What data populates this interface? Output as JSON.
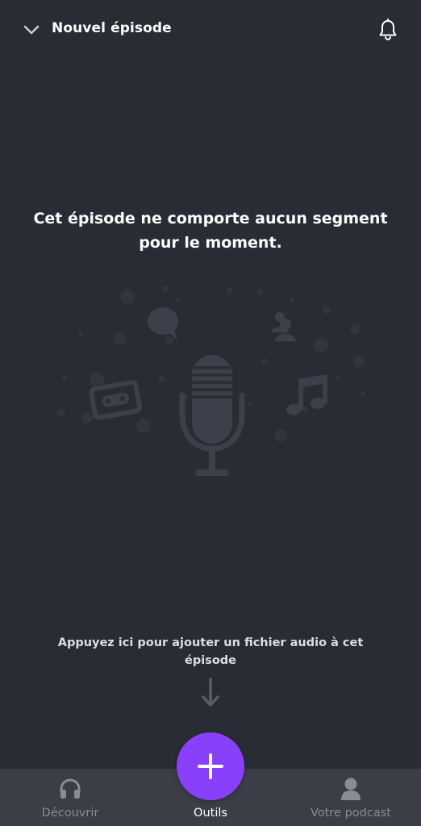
{
  "header": {
    "title": "Nouvel épisode",
    "collapse_icon": "chevron-down-icon",
    "notification_icon": "bell-icon"
  },
  "empty_state": {
    "message": "Cet épisode ne comporte aucun segment pour le moment.",
    "illustration_icons": [
      "microphone-icon",
      "speech-bubble-icon",
      "users-icon",
      "cassette-icon",
      "music-note-icon"
    ]
  },
  "hint": {
    "text": "Appuyez ici pour ajouter un fichier audio à cet épisode",
    "arrow_icon": "arrow-down-icon"
  },
  "fab": {
    "icon": "plus-icon",
    "color": "#8940fa"
  },
  "bottom_nav": {
    "items": [
      {
        "label": "Découvrir",
        "icon": "headphones-icon",
        "active": false
      },
      {
        "label": "Outils",
        "icon": "tools-icon",
        "active": true
      },
      {
        "label": "Votre podcast",
        "icon": "user-icon",
        "active": false
      }
    ]
  },
  "colors": {
    "background": "#292c35",
    "nav_background": "#3b3e47",
    "accent": "#8940fa",
    "illustration": "#3c404b"
  }
}
